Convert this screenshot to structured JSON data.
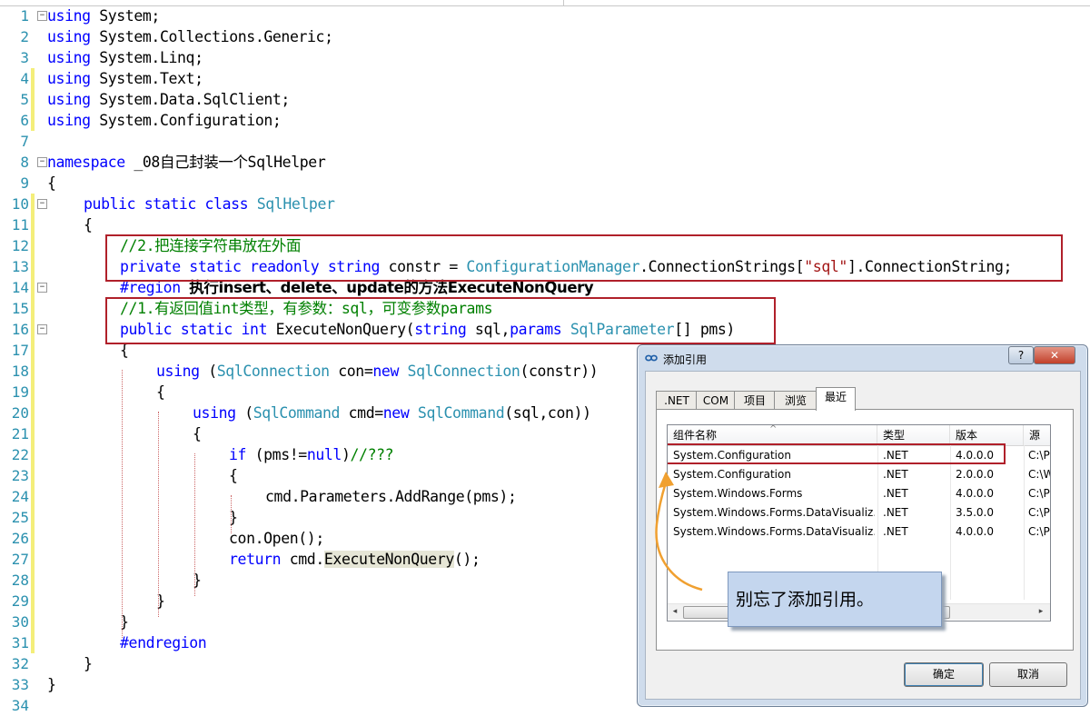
{
  "editor": {
    "lines": [
      {
        "n": "1",
        "fold": "⊟",
        "segs": [
          {
            "c": "kw",
            "t": "using"
          },
          {
            "c": "",
            "t": " System;"
          }
        ]
      },
      {
        "n": "2",
        "segs": [
          {
            "c": "kw",
            "t": "using"
          },
          {
            "c": "",
            "t": " System.Collections.Generic;"
          }
        ]
      },
      {
        "n": "3",
        "segs": [
          {
            "c": "kw",
            "t": "using"
          },
          {
            "c": "",
            "t": " System.Linq;"
          }
        ]
      },
      {
        "n": "4",
        "changed": true,
        "segs": [
          {
            "c": "kw",
            "t": "using"
          },
          {
            "c": "",
            "t": " System.Text;"
          }
        ]
      },
      {
        "n": "5",
        "changed": true,
        "segs": [
          {
            "c": "kw",
            "t": "using"
          },
          {
            "c": "",
            "t": " System.Data.SqlClient;"
          }
        ]
      },
      {
        "n": "6",
        "changed": true,
        "segs": [
          {
            "c": "kw",
            "t": "using"
          },
          {
            "c": "",
            "t": " System.Configuration;"
          }
        ]
      },
      {
        "n": "7",
        "segs": []
      },
      {
        "n": "8",
        "fold": "⊟",
        "segs": [
          {
            "c": "kw",
            "t": "namespace"
          },
          {
            "c": "",
            "t": " _08自己封装一个SqlHelper"
          }
        ]
      },
      {
        "n": "9",
        "segs": [
          {
            "c": "",
            "t": "{"
          }
        ]
      },
      {
        "n": "10",
        "fold": "⊟",
        "changed": true,
        "indent": 1,
        "segs": [
          {
            "c": "kw",
            "t": "public"
          },
          {
            "c": "",
            "t": " "
          },
          {
            "c": "kw",
            "t": "static"
          },
          {
            "c": "",
            "t": " "
          },
          {
            "c": "kw",
            "t": "class"
          },
          {
            "c": "",
            "t": " "
          },
          {
            "c": "ty",
            "t": "SqlHelper"
          }
        ]
      },
      {
        "n": "11",
        "changed": true,
        "indent": 1,
        "segs": [
          {
            "c": "",
            "t": "{"
          }
        ]
      },
      {
        "n": "12",
        "changed": true,
        "indent": 2,
        "segs": [
          {
            "c": "cm",
            "t": "//2.把连接字符串放在外面"
          }
        ]
      },
      {
        "n": "13",
        "changed": true,
        "indent": 2,
        "segs": [
          {
            "c": "kw",
            "t": "private"
          },
          {
            "c": "",
            "t": " "
          },
          {
            "c": "kw",
            "t": "static"
          },
          {
            "c": "",
            "t": " "
          },
          {
            "c": "kw",
            "t": "readonly"
          },
          {
            "c": "",
            "t": " "
          },
          {
            "c": "kw",
            "t": "string"
          },
          {
            "c": "",
            "t": " constr = "
          },
          {
            "c": "ty",
            "t": "ConfigurationManager"
          },
          {
            "c": "",
            "t": ".ConnectionStrings["
          },
          {
            "c": "st",
            "t": "\"sql\""
          },
          {
            "c": "",
            "t": "].ConnectionString;"
          }
        ]
      },
      {
        "n": "14",
        "fold": "⊟",
        "changed": true,
        "indent": 2,
        "segs": [
          {
            "c": "rg",
            "t": "#region"
          },
          {
            "c": "",
            "t": " "
          },
          {
            "c": "bold",
            "t": "执行insert、delete、update的方法ExecuteNonQuery"
          }
        ]
      },
      {
        "n": "15",
        "changed": true,
        "indent": 2,
        "segs": [
          {
            "c": "cm",
            "t": "//1.有返回值int类型，有参数：sql，可变参数params"
          }
        ]
      },
      {
        "n": "16",
        "fold": "⊟",
        "changed": true,
        "indent": 2,
        "segs": [
          {
            "c": "kw",
            "t": "public"
          },
          {
            "c": "",
            "t": " "
          },
          {
            "c": "kw",
            "t": "static"
          },
          {
            "c": "",
            "t": " "
          },
          {
            "c": "kw",
            "t": "int"
          },
          {
            "c": "",
            "t": " ExecuteNonQuery("
          },
          {
            "c": "kw",
            "t": "string"
          },
          {
            "c": "",
            "t": " sql,"
          },
          {
            "c": "kw",
            "t": "params"
          },
          {
            "c": "",
            "t": " "
          },
          {
            "c": "ty",
            "t": "SqlParameter"
          },
          {
            "c": "",
            "t": "[] pms)"
          }
        ]
      },
      {
        "n": "17",
        "changed": true,
        "indent": 2,
        "segs": [
          {
            "c": "",
            "t": "{"
          }
        ]
      },
      {
        "n": "18",
        "changed": true,
        "indent": 3,
        "segs": [
          {
            "c": "kw",
            "t": "using"
          },
          {
            "c": "",
            "t": " ("
          },
          {
            "c": "ty",
            "t": "SqlConnection"
          },
          {
            "c": "",
            "t": " con="
          },
          {
            "c": "kw",
            "t": "new"
          },
          {
            "c": "",
            "t": " "
          },
          {
            "c": "ty",
            "t": "SqlConnection"
          },
          {
            "c": "",
            "t": "(constr))"
          }
        ]
      },
      {
        "n": "19",
        "changed": true,
        "indent": 3,
        "segs": [
          {
            "c": "",
            "t": "{"
          }
        ]
      },
      {
        "n": "20",
        "changed": true,
        "indent": 4,
        "segs": [
          {
            "c": "kw",
            "t": "using"
          },
          {
            "c": "",
            "t": " ("
          },
          {
            "c": "ty",
            "t": "SqlCommand"
          },
          {
            "c": "",
            "t": " cmd="
          },
          {
            "c": "kw",
            "t": "new"
          },
          {
            "c": "",
            "t": " "
          },
          {
            "c": "ty",
            "t": "SqlCommand"
          },
          {
            "c": "",
            "t": "(sql,con))"
          }
        ]
      },
      {
        "n": "21",
        "changed": true,
        "indent": 4,
        "segs": [
          {
            "c": "",
            "t": "{"
          }
        ]
      },
      {
        "n": "22",
        "changed": true,
        "indent": 5,
        "segs": [
          {
            "c": "kw",
            "t": "if"
          },
          {
            "c": "",
            "t": " (pms!="
          },
          {
            "c": "kw",
            "t": "null"
          },
          {
            "c": "",
            "t": ")"
          },
          {
            "c": "cm",
            "t": "//???"
          }
        ]
      },
      {
        "n": "23",
        "changed": true,
        "indent": 5,
        "segs": [
          {
            "c": "",
            "t": "{"
          }
        ]
      },
      {
        "n": "24",
        "changed": true,
        "indent": 6,
        "segs": [
          {
            "c": "",
            "t": "cmd.Parameters.AddRange(pms);"
          }
        ]
      },
      {
        "n": "25",
        "changed": true,
        "indent": 5,
        "segs": [
          {
            "c": "",
            "t": "}"
          }
        ]
      },
      {
        "n": "26",
        "changed": true,
        "indent": 5,
        "segs": [
          {
            "c": "",
            "t": "con.Open();"
          }
        ]
      },
      {
        "n": "27",
        "changed": true,
        "indent": 5,
        "segs": [
          {
            "c": "kw",
            "t": "return"
          },
          {
            "c": "",
            "t": " cmd."
          },
          {
            "c": "hl",
            "t": "ExecuteNonQuery"
          },
          {
            "c": "",
            "t": "();"
          }
        ]
      },
      {
        "n": "28",
        "changed": true,
        "indent": 4,
        "segs": [
          {
            "c": "",
            "t": "}"
          }
        ]
      },
      {
        "n": "29",
        "changed": true,
        "indent": 3,
        "segs": [
          {
            "c": "",
            "t": "}"
          }
        ]
      },
      {
        "n": "30",
        "changed": true,
        "indent": 2,
        "segs": [
          {
            "c": "",
            "t": "}"
          }
        ]
      },
      {
        "n": "31",
        "changed": true,
        "indent": 2,
        "segs": [
          {
            "c": "rg",
            "t": "#endregion"
          }
        ]
      },
      {
        "n": "32",
        "indent": 1,
        "segs": [
          {
            "c": "",
            "t": "}"
          }
        ]
      },
      {
        "n": "33",
        "segs": [
          {
            "c": "",
            "t": "}"
          }
        ]
      },
      {
        "n": "34",
        "segs": []
      }
    ]
  },
  "dialog": {
    "title": "添加引用",
    "help": "?",
    "close": "✕",
    "tabs": [
      ".NET",
      "COM",
      "项目",
      "浏览",
      "最近"
    ],
    "active_tab": "最近",
    "columns": [
      "组件名称",
      "类型",
      "版本",
      "源"
    ],
    "rows": [
      {
        "name": "System.Configuration",
        "type": ".NET",
        "version": "4.0.0.0",
        "src": "C:\\P"
      },
      {
        "name": "System.Configuration",
        "type": ".NET",
        "version": "2.0.0.0",
        "src": "C:\\W"
      },
      {
        "name": "System.Windows.Forms",
        "type": ".NET",
        "version": "4.0.0.0",
        "src": "C:\\P"
      },
      {
        "name": "System.Windows.Forms.DataVisualiz...",
        "type": ".NET",
        "version": "3.5.0.0",
        "src": "C:\\P"
      },
      {
        "name": "System.Windows.Forms.DataVisualiz...",
        "type": ".NET",
        "version": "4.0.0.0",
        "src": "C:\\P"
      }
    ],
    "callout": "别忘了添加引用。",
    "ok": "确定",
    "cancel": "取消",
    "scroll_grip": "III",
    "scroll_left": "◂",
    "scroll_right": "▸",
    "sort_arrow": "^"
  },
  "colors": {
    "keyword": "#0000ff",
    "type": "#2b91af",
    "comment": "#008000",
    "string": "#a31515",
    "annotation_box": "#b0202a",
    "callout_arrow": "#f0a030"
  }
}
